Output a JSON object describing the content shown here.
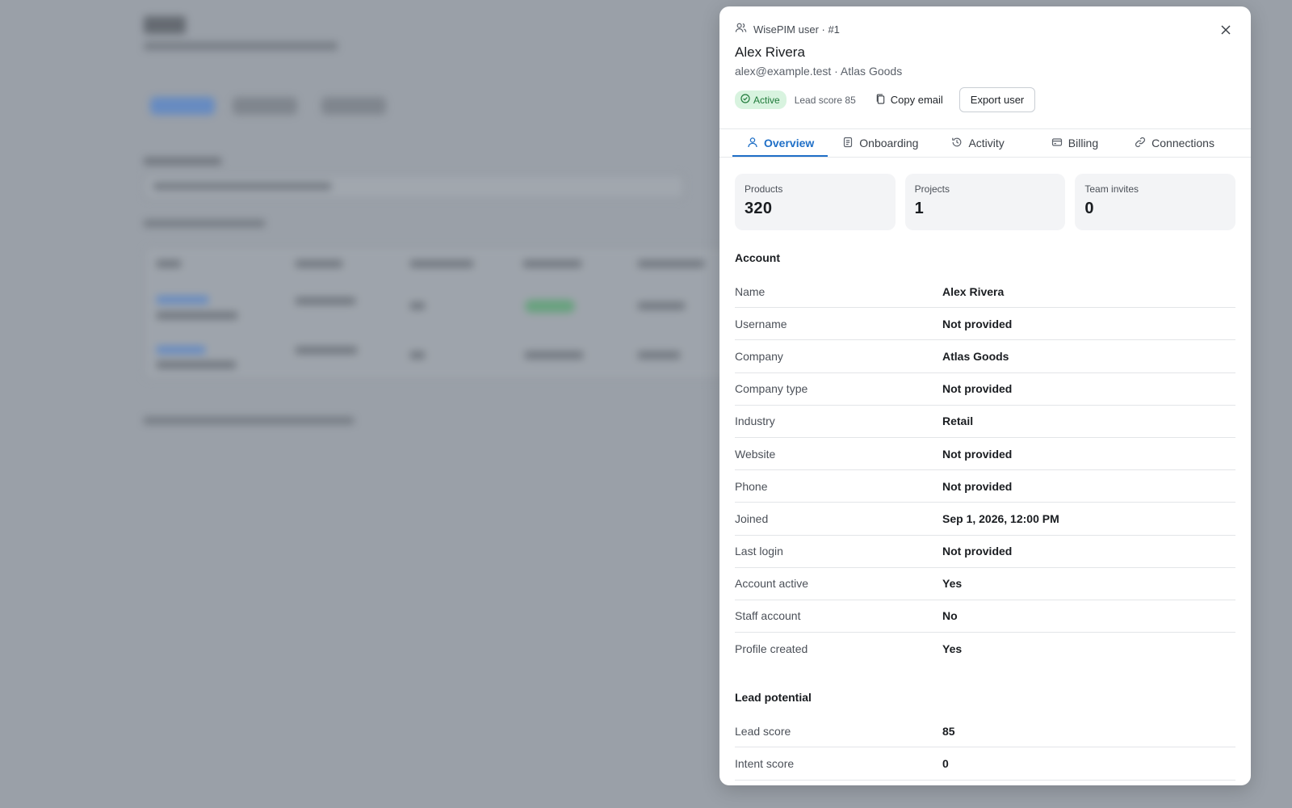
{
  "drawer": {
    "kicker": "WisePIM user · #1",
    "name": "Alex Rivera",
    "subtitle": "alex@example.test · Atlas Goods",
    "status_badge": "Active",
    "lead_score_text": "Lead score 85",
    "copy_email_label": "Copy email",
    "export_label": "Export user"
  },
  "tabs": [
    {
      "label": "Overview",
      "icon": "user-icon",
      "active": true
    },
    {
      "label": "Onboarding",
      "icon": "document-icon",
      "active": false
    },
    {
      "label": "Activity",
      "icon": "history-icon",
      "active": false
    },
    {
      "label": "Billing",
      "icon": "card-icon",
      "active": false
    },
    {
      "label": "Connections",
      "icon": "link-icon",
      "active": false
    }
  ],
  "stats": [
    {
      "label": "Products",
      "value": "320"
    },
    {
      "label": "Projects",
      "value": "1"
    },
    {
      "label": "Team invites",
      "value": "0"
    }
  ],
  "account": {
    "title": "Account",
    "rows": [
      {
        "label": "Name",
        "value": "Alex Rivera"
      },
      {
        "label": "Username",
        "value": "Not provided"
      },
      {
        "label": "Company",
        "value": "Atlas Goods"
      },
      {
        "label": "Company type",
        "value": "Not provided"
      },
      {
        "label": "Industry",
        "value": "Retail"
      },
      {
        "label": "Website",
        "value": "Not provided"
      },
      {
        "label": "Phone",
        "value": "Not provided"
      },
      {
        "label": "Joined",
        "value": "Sep 1, 2026, 12:00 PM"
      },
      {
        "label": "Last login",
        "value": "Not provided"
      },
      {
        "label": "Account active",
        "value": "Yes"
      },
      {
        "label": "Staff account",
        "value": "No"
      },
      {
        "label": "Profile created",
        "value": "Yes"
      }
    ]
  },
  "lead": {
    "title": "Lead potential",
    "rows": [
      {
        "label": "Lead score",
        "value": "85"
      },
      {
        "label": "Intent score",
        "value": "0"
      }
    ]
  },
  "colors": {
    "accent": "#1f6fc7",
    "active_badge_bg": "#d8f3df",
    "active_badge_text": "#1f7a3a",
    "overlay": "#9aa0a8"
  }
}
